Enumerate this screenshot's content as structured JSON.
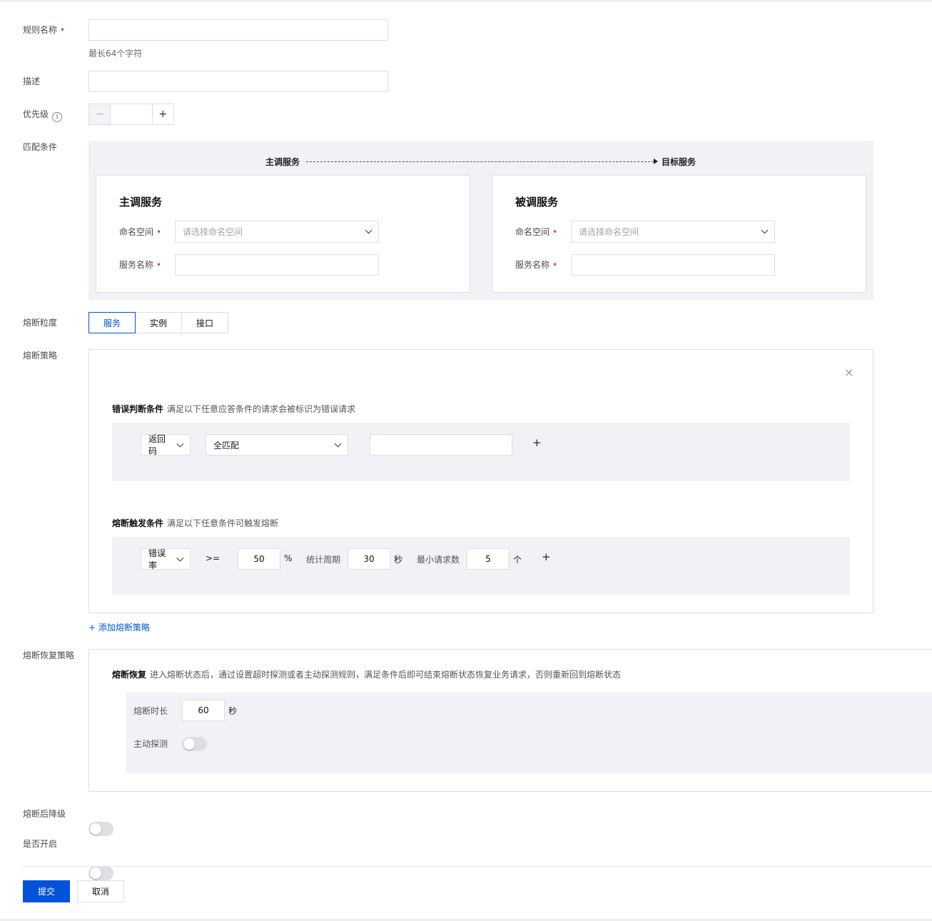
{
  "form": {
    "rule_name": {
      "label": "规则名称",
      "value": "",
      "hint": "最长64个字符"
    },
    "description": {
      "label": "描述",
      "value": ""
    },
    "priority": {
      "label": "优先级",
      "minus": "−",
      "plus": "+",
      "value": "",
      "info_icon": "info-icon"
    },
    "match": {
      "label": "匹配条件",
      "flow_from": "主调服务",
      "flow_to": "目标服务",
      "caller": {
        "title": "主调服务",
        "namespace_label": "命名空间",
        "namespace_placeholder": "请选择命名空间",
        "service_label": "服务名称",
        "service_value": ""
      },
      "callee": {
        "title": "被调服务",
        "namespace_label": "命名空间",
        "namespace_placeholder": "请选择命名空间",
        "service_label": "服务名称",
        "service_value": ""
      }
    },
    "granularity": {
      "label": "熔断粒度",
      "options": [
        "服务",
        "实例",
        "接口"
      ],
      "selected": "服务"
    },
    "strategy": {
      "label": "熔断策略",
      "close": "×",
      "error_condition": {
        "title": "错误判断条件",
        "desc": "满足以下任意应答条件的请求会被标识为错误请求",
        "type": "返回码",
        "match": "全匹配",
        "value": "",
        "add": "+"
      },
      "trigger_condition": {
        "title": "熔断触发条件",
        "desc": "满足以下任意条件可触发熔断",
        "type": "错误率",
        "operator": ">=",
        "rate": "50",
        "rate_unit": "%",
        "period_label": "统计周期",
        "period": "30",
        "period_unit": "秒",
        "min_requests_label": "最小请求数",
        "min_requests": "5",
        "min_requests_unit": "个",
        "add": "+"
      },
      "add_link": "+ 添加熔断策略"
    },
    "recovery": {
      "label": "熔断恢复策略",
      "title": "熔断恢复",
      "desc": "进入熔断状态后，通过设置超时探测或者主动探测规则，满足条件后即可结束熔断状态恢复业务请求，否则重新回到熔断状态",
      "duration_label": "熔断时长",
      "duration": "60",
      "duration_unit": "秒",
      "probe_label": "主动探测",
      "probe_enabled": false
    },
    "degrade": {
      "label": "熔断后降级",
      "enabled": false
    },
    "enabled": {
      "label": "是否开启",
      "enabled": false
    }
  },
  "actions": {
    "submit": "提交",
    "cancel": "取消"
  },
  "colors": {
    "primary": "#0052d9",
    "required": "#e54545",
    "panel_bg": "#f1f2f5"
  }
}
